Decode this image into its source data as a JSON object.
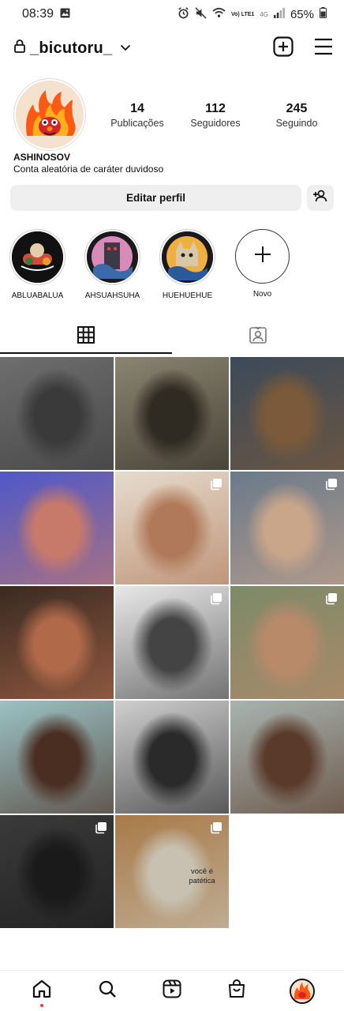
{
  "status_bar": {
    "time": "08:39",
    "battery": "65%",
    "network": "4G",
    "volte": "Vo) LTE1"
  },
  "header": {
    "username": "_bicutoru_",
    "icons": [
      "lock-icon",
      "chevron-down-icon",
      "new-post-icon",
      "menu-icon"
    ]
  },
  "profile": {
    "display_name": "ASHINOSOV",
    "bio": "Conta aleatória de caráter duvidoso",
    "stats": [
      {
        "value": "14",
        "label": "Publicações"
      },
      {
        "value": "112",
        "label": "Seguidores"
      },
      {
        "value": "245",
        "label": "Seguindo"
      }
    ],
    "edit_label": "Editar perfil"
  },
  "highlights": [
    {
      "label": "ABLUABALUA"
    },
    {
      "label": "AHSUAHSUHA"
    },
    {
      "label": "HUEHUEHUE"
    }
  ],
  "new_highlight_label": "Novo",
  "grid": {
    "cells": [
      {
        "colors": [
          "#6e6e6e",
          "#3a3a3a"
        ],
        "multi": false
      },
      {
        "colors": [
          "#8a8470",
          "#2f2b22"
        ],
        "multi": false
      },
      {
        "colors": [
          "#3c4a5a",
          "#7a5a3a"
        ],
        "multi": false
      },
      {
        "colors": [
          "#4f58c8",
          "#c87a6a"
        ],
        "multi": false
      },
      {
        "colors": [
          "#e6dccd",
          "#b07a5a"
        ],
        "multi": true
      },
      {
        "colors": [
          "#6a7a8a",
          "#c9a58a"
        ],
        "multi": true
      },
      {
        "colors": [
          "#3a2a22",
          "#b06a4a"
        ],
        "multi": false
      },
      {
        "colors": [
          "#e8e8e8",
          "#444444"
        ],
        "multi": true
      },
      {
        "colors": [
          "#7c8a68",
          "#b98a6a"
        ],
        "multi": true
      },
      {
        "colors": [
          "#9bc2c4",
          "#4a2e22"
        ],
        "multi": false
      },
      {
        "colors": [
          "#cfcfcf",
          "#2a2a2a"
        ],
        "multi": false
      },
      {
        "colors": [
          "#a8b4b0",
          "#5a3a2a"
        ],
        "multi": false
      },
      {
        "colors": [
          "#3a3a3a",
          "#1a1a1a"
        ],
        "multi": true
      },
      {
        "colors": [
          "#a87a48",
          "#c8c0b0"
        ],
        "multi": true,
        "caption": "você é patética"
      }
    ]
  },
  "colors": {
    "button_bg": "#efefef",
    "notification_dot": "#ff3040",
    "text": "#111111"
  }
}
